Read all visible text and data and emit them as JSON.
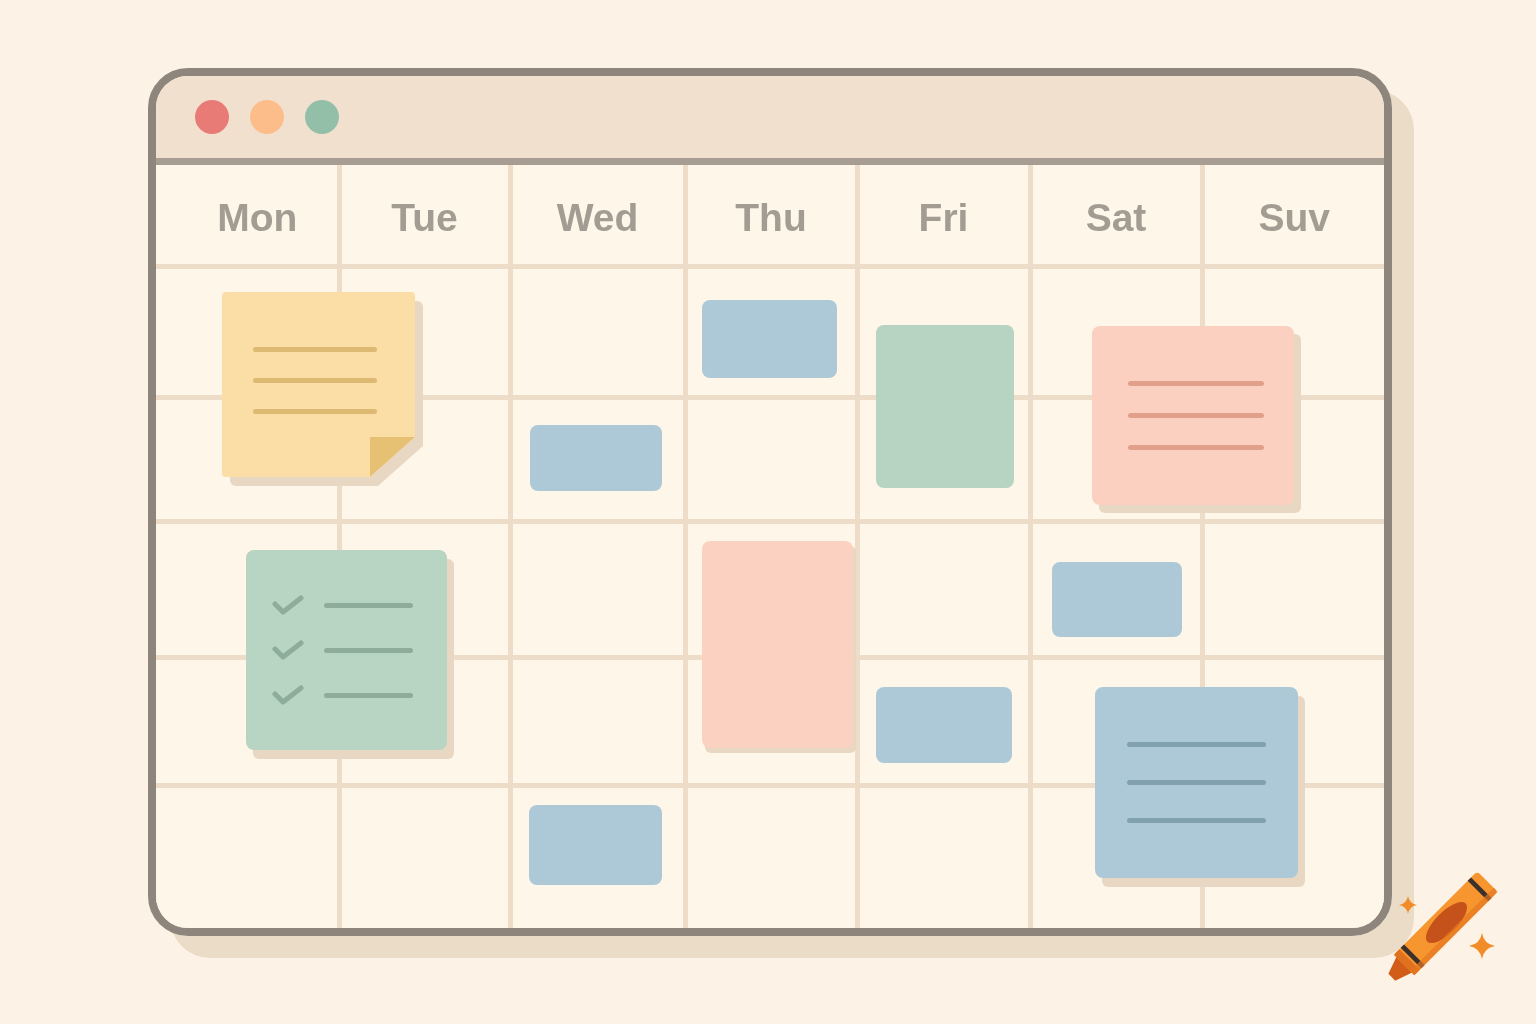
{
  "window": {
    "controls": [
      {
        "color": "#e97b77"
      },
      {
        "color": "#fcbd8a"
      },
      {
        "color": "#93bfa9"
      }
    ]
  },
  "calendar": {
    "days": [
      "Mon",
      "Tue",
      "Wed",
      "Thu",
      "Fri",
      "Sat",
      "Suv"
    ],
    "notes": [
      {
        "kind": "sticky",
        "color": "#fadea6"
      },
      {
        "kind": "block",
        "color": "#adc9d7"
      },
      {
        "kind": "block",
        "color": "#b7d3c1"
      },
      {
        "kind": "lined",
        "color": "#fbd0c1"
      },
      {
        "kind": "block",
        "color": "#adc9d7"
      },
      {
        "kind": "checklist",
        "color": "#b8d4c2",
        "items": [
          {
            "checked": true
          },
          {
            "checked": true
          },
          {
            "checked": true
          }
        ]
      },
      {
        "kind": "block",
        "color": "#fbd2c2"
      },
      {
        "kind": "block",
        "color": "#adc9d7"
      },
      {
        "kind": "block",
        "color": "#adc9d7"
      },
      {
        "kind": "lined",
        "color": "#adc9d7"
      },
      {
        "kind": "block",
        "color": "#adc9d7"
      }
    ]
  }
}
